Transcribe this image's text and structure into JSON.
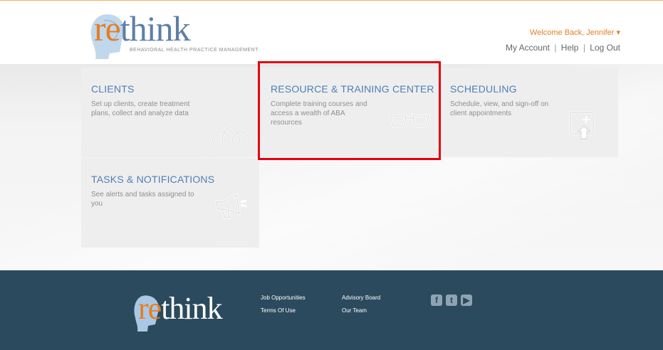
{
  "header": {
    "logo": {
      "word_prefix": "re",
      "word_rest": "think",
      "tagline": "BEHAVIORAL HEALTH PRACTICE MANAGEMENT"
    },
    "welcome": "Welcome Back, Jennifer ▾",
    "links": {
      "my_account": "My Account",
      "help": "Help",
      "log_out": "Log Out",
      "separator": "|"
    }
  },
  "tiles": {
    "clients": {
      "title": "CLIENTS",
      "desc": "Set up clients, create treatment plans, collect and analyze data",
      "icon": "people-group-icon"
    },
    "resources": {
      "title": "RESOURCE & TRAINING CENTER",
      "desc": "Complete training courses and access a wealth of ABA resources",
      "icon": "eyeglasses-icon"
    },
    "scheduling": {
      "title": "SCHEDULING",
      "desc": "Schedule, view, and sign-off on client appointments",
      "icon": "calendar-icon"
    },
    "tasks": {
      "title": "TASKS & NOTIFICATIONS",
      "desc": "See alerts and tasks assigned to you",
      "icon": "megaphone-icon"
    }
  },
  "footer": {
    "logo": {
      "word_prefix": "re",
      "word_rest": "think"
    },
    "links_col1": [
      "Job Opportunities",
      "Terms Of Use"
    ],
    "links_col2": [
      "Advisory Board",
      "Our Team"
    ],
    "social": [
      "facebook-icon",
      "twitter-icon",
      "youtube-icon"
    ]
  },
  "colors": {
    "accent_orange": "#e67e22",
    "tile_title_blue": "#4f7fb3",
    "footer_bg": "#2b4a5e",
    "highlight_red": "#e3000f"
  }
}
